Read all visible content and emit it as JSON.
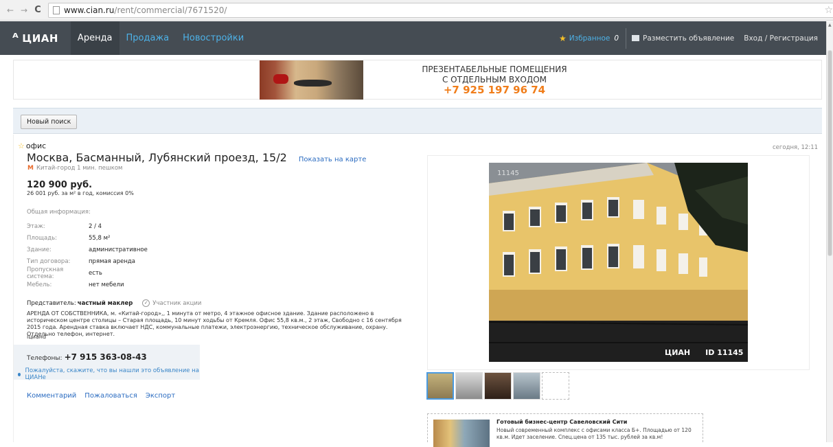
{
  "browser": {
    "url_host": "www.cian.ru",
    "url_path": "/rent/commercial/7671520/"
  },
  "header": {
    "logo": "ЦИАН",
    "nav": [
      "Аренда",
      "Продажа",
      "Новостройки"
    ],
    "favorites_label": "Избранное",
    "favorites_count": "0",
    "post_ad": "Разместить объявление",
    "login": "Вход / Регистрация"
  },
  "banner": {
    "line1": "ПРЕЗЕНТАБЕЛЬНЫЕ ПОМЕЩЕНИЯ",
    "line2": "С ОТДЕЛЬНЫМ ВХОДОМ",
    "phone": "+7 925 197 96 74"
  },
  "search": {
    "new_search": "Новый поиск"
  },
  "listing": {
    "type": "офис",
    "date": "сегодня, 12:11",
    "address": "Москва, Басманный, Лубянский проезд, 15/2",
    "show_map": "Показать на карте",
    "metro": "Китай-город 1 мин. пешком",
    "price": "120 900 руб.",
    "price_sub": "26 001 руб. за м² в год, комиссия 0%",
    "info_head": "Общая информация:",
    "info": [
      {
        "k": "Этаж:",
        "v": "2 / 4"
      },
      {
        "k": "Площадь:",
        "v": "55,8 м²"
      },
      {
        "k": "Здание:",
        "v": "административное"
      },
      {
        "k": "Тип договора:",
        "v": "прямая аренда"
      },
      {
        "k": "Пропускная система:",
        "v": "есть"
      },
      {
        "k": "Мебель:",
        "v": "нет мебели"
      }
    ],
    "agent_label": "Представитель:",
    "agent_name": "частный маклер",
    "promo_label": "Участник акции",
    "description": "АРЕНДА ОТ СОБСТВЕННИКА, м. «Китай-город»,, 1 минута от метро, 4 этажное офисное здание. Здание расположено в историческом центре столицы – Старая площадь, 10 минут ходьбы от Кремля. Офис 55,8 кв.м., 2 этаж, Свободно с 16 сентября 2015 года. Арендная ставка включает НДС, коммунальные платежи, электроэнергию, техническое обслуживание, охрану. Отдельно телефон, интернет.",
    "description_sign": "iцианd",
    "phone_label": "Телефоны:",
    "phone": "+7 915 363-08-43",
    "phone_hint": "Пожалуйста, скажите, что вы нашли это объявление на ЦИАНе",
    "actions": [
      "Комментарий",
      "Пожаловаться",
      "Экспорт"
    ]
  },
  "photo": {
    "id_top": "11145",
    "wm_logo": "ЦИАН",
    "wm_id": "ID 11145"
  },
  "ad": {
    "title": "Готовый бизнес-центр Савеловский Сити",
    "text": "Новый современный комплекс с офисами класса Б+. Площадью от 120 кв.м. Идет заселение. Спец.цена от 135 тыс. рублей за кв.м!"
  },
  "colors": {
    "header_bg": "#454c53",
    "link_blue": "#2a6bc0",
    "nav_blue": "#4db2e8",
    "accent_orange": "#f07d1a"
  }
}
